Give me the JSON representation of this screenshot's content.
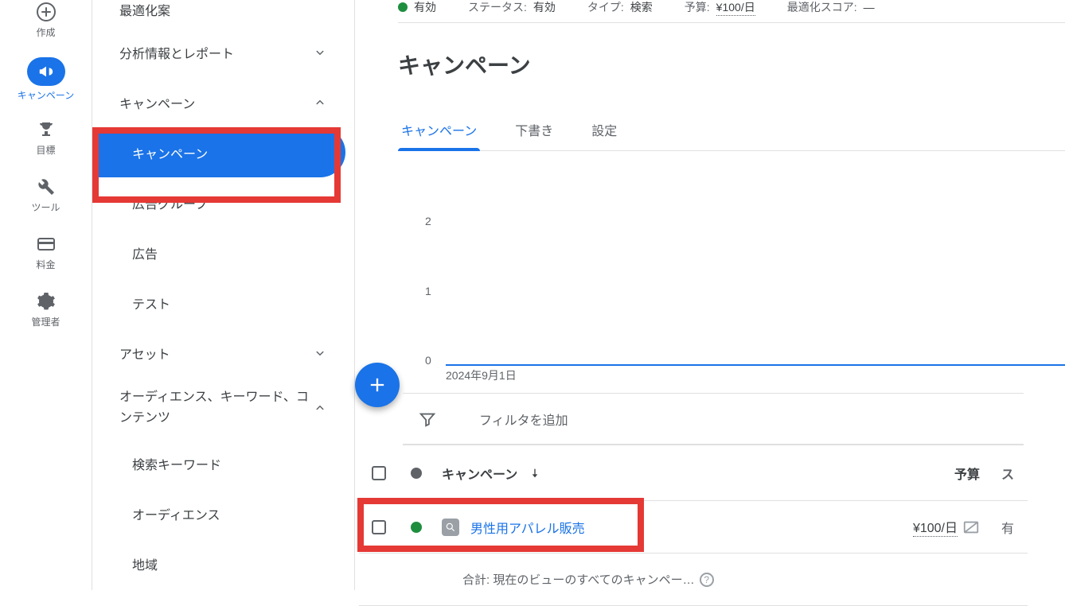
{
  "leftRail": {
    "create": "作成",
    "campaign": "キャンペーン",
    "goal": "目標",
    "tool": "ツール",
    "fee": "料金",
    "admin": "管理者"
  },
  "secondaryNav": {
    "optimization": "最適化案",
    "insights": "分析情報とレポート",
    "campaignGroup": "キャンペーン",
    "campaignSub": "キャンペーン",
    "adGroup": "広告グループ",
    "ads": "広告",
    "test": "テスト",
    "asset": "アセット",
    "audienceGroup": "オーディエンス、キーワード、コンテンツ",
    "searchKw": "検索キーワード",
    "audience": "オーディエンス",
    "region": "地域"
  },
  "summary": {
    "enabledLabel": "有効",
    "statusLabel": "ステータス:",
    "statusValue": "有効",
    "typeLabel": "タイプ:",
    "typeValue": "検索",
    "budgetLabel": "予算:",
    "budgetValue": "¥100/日",
    "optScoreLabel": "最適化スコア:",
    "optScoreValue": "—"
  },
  "pageTitle": "キャンペーン",
  "tabs": {
    "campaign": "キャンペーン",
    "draft": "下書き",
    "settings": "設定"
  },
  "chart_data": {
    "type": "line",
    "x": [
      "2024年9月1日"
    ],
    "series": [
      {
        "name": "",
        "values": [
          0
        ]
      }
    ],
    "xlabel": "",
    "ylabel": "",
    "yticks": [
      "0",
      "1",
      "2"
    ],
    "ylim": [
      0,
      2
    ],
    "startDate": "2024年9月1日"
  },
  "filter": {
    "addFilter": "フィルタを追加"
  },
  "table": {
    "colCampaign": "キャンペーン",
    "colBudget": "予算",
    "colLast": "ス",
    "row1": {
      "name": "男性用アパレル販売",
      "budget": "¥100/日",
      "last": "有"
    },
    "summary": "合計: 現在のビューのすべてのキャンペー…"
  }
}
